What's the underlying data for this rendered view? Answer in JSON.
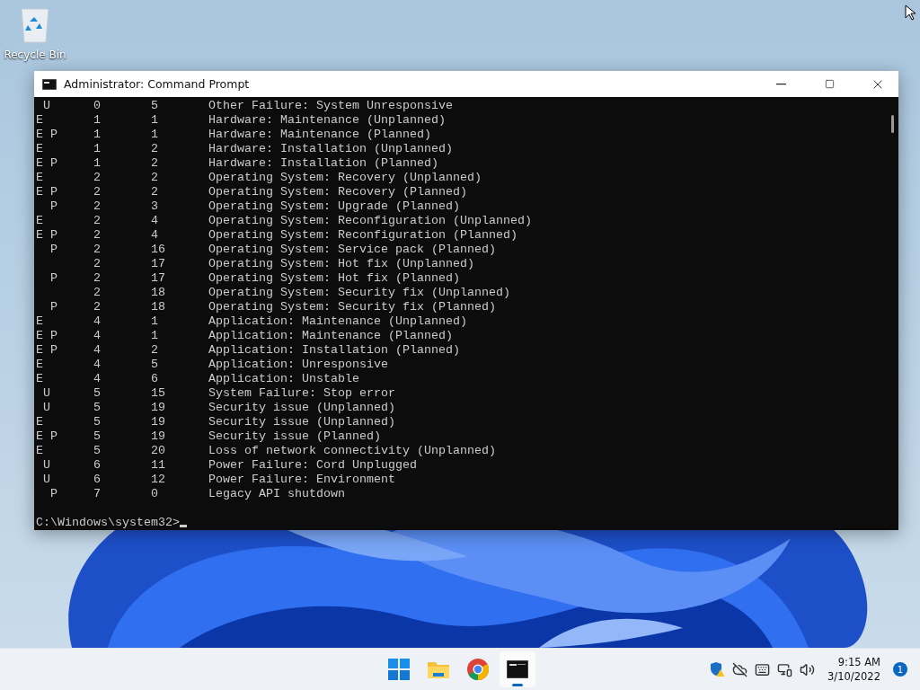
{
  "desktop": {
    "icons": [
      {
        "label": "Recycle Bin"
      }
    ]
  },
  "window": {
    "title": "Administrator: Command Prompt",
    "lines": [
      " U      0       5       Other Failure: System Unresponsive",
      "E       1       1       Hardware: Maintenance (Unplanned)",
      "E P     1       1       Hardware: Maintenance (Planned)",
      "E       1       2       Hardware: Installation (Unplanned)",
      "E P     1       2       Hardware: Installation (Planned)",
      "E       2       2       Operating System: Recovery (Unplanned)",
      "E P     2       2       Operating System: Recovery (Planned)",
      "  P     2       3       Operating System: Upgrade (Planned)",
      "E       2       4       Operating System: Reconfiguration (Unplanned)",
      "E P     2       4       Operating System: Reconfiguration (Planned)",
      "  P     2       16      Operating System: Service pack (Planned)",
      "        2       17      Operating System: Hot fix (Unplanned)",
      "  P     2       17      Operating System: Hot fix (Planned)",
      "        2       18      Operating System: Security fix (Unplanned)",
      "  P     2       18      Operating System: Security fix (Planned)",
      "E       4       1       Application: Maintenance (Unplanned)",
      "E P     4       1       Application: Maintenance (Planned)",
      "E P     4       2       Application: Installation (Planned)",
      "E       4       5       Application: Unresponsive",
      "E       4       6       Application: Unstable",
      " U      5       15      System Failure: Stop error",
      " U      5       19      Security issue (Unplanned)",
      "E       5       19      Security issue (Unplanned)",
      "E P     5       19      Security issue (Planned)",
      "E       5       20      Loss of network connectivity (Unplanned)",
      " U      6       11      Power Failure: Cord Unplugged",
      " U      6       12      Power Failure: Environment",
      "  P     7       0       Legacy API shutdown"
    ],
    "prompt": "C:\\Windows\\system32>"
  },
  "taskbar": {
    "apps": [
      {
        "kind": "start",
        "selected": false
      },
      {
        "kind": "folder",
        "selected": false
      },
      {
        "kind": "browser",
        "selected": false
      },
      {
        "kind": "terminal",
        "selected": true
      }
    ],
    "tray": [
      {
        "kind": "shield"
      },
      {
        "kind": "cloud"
      },
      {
        "kind": "keyboard"
      },
      {
        "kind": "network"
      },
      {
        "kind": "volume"
      }
    ],
    "clock": {
      "time": "9:15 AM",
      "date": "3/10/2022"
    },
    "notifications": "1"
  }
}
